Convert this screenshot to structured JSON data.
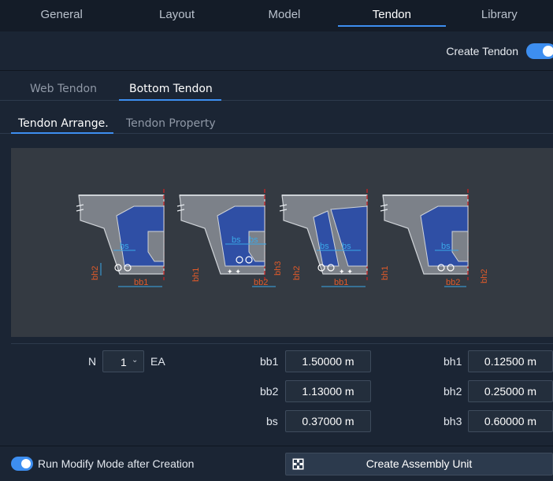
{
  "top_tabs": [
    "General",
    "Layout",
    "Model",
    "Tendon",
    "Library"
  ],
  "active_top_tab": "Tendon",
  "create_tendon": {
    "label": "Create Tendon",
    "enabled": true
  },
  "sub_tabs": [
    "Web Tendon",
    "Bottom Tendon"
  ],
  "active_sub_tab": "Bottom Tendon",
  "inner_tabs": [
    "Tendon Arrange.",
    "Tendon Property"
  ],
  "active_inner_tab": "Tendon Arrange.",
  "diagram": {
    "labels": [
      "bs",
      "bb1",
      "bb2",
      "bh1",
      "bh2",
      "bh3"
    ]
  },
  "params": {
    "n": {
      "label": "N",
      "value": "1",
      "unit": "EA"
    },
    "bb1": {
      "label": "bb1",
      "value": "1.50000 m"
    },
    "bb2": {
      "label": "bb2",
      "value": "1.13000 m"
    },
    "bs": {
      "label": "bs",
      "value": "0.37000 m"
    },
    "bh1": {
      "label": "bh1",
      "value": "0.12500 m"
    },
    "bh2": {
      "label": "bh2",
      "value": "0.25000 m"
    },
    "bh3": {
      "label": "bh3",
      "value": "0.60000 m"
    }
  },
  "footer": {
    "run_modify_label": "Run Modify Mode after Creation",
    "run_modify_enabled": true,
    "create_assembly_label": "Create Assembly Unit"
  },
  "colors": {
    "accent": "#3d8ef0",
    "section_fill": "#2f4fa5",
    "dimension_orange": "#e05a2a",
    "dimension_blue": "#3aa8e8",
    "centerline_red": "#d02020"
  }
}
